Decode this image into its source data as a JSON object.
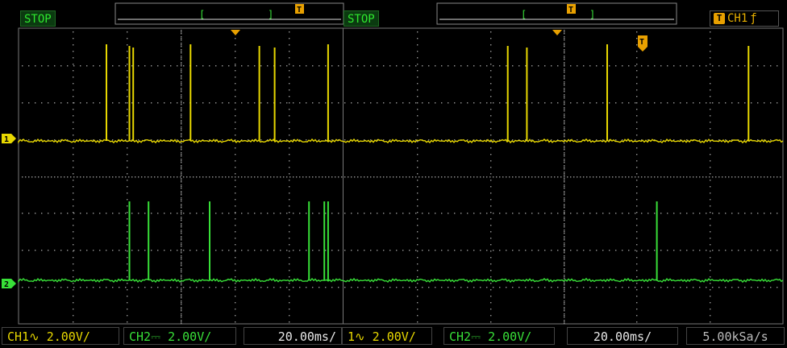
{
  "left_half": {
    "status": "STOP",
    "ch1_setting": "CH1∿  2.00V/",
    "ch2_setting": "CH2⎓  2.00V/",
    "timebase": "20.00ms/"
  },
  "right_half": {
    "status": "STOP",
    "ch1_setting": "1∿  2.00V/",
    "ch2_setting": "CH2⎓  2.00V/",
    "timebase": "20.00ms/",
    "sample_rate": "5.00kSa/s"
  },
  "trigger": {
    "source": "CH1",
    "edge_symbol": "ƒ",
    "marker_letter": "T"
  },
  "channel_markers": {
    "ch1": "1",
    "ch2": "2"
  },
  "colors": {
    "ch1": "#e8d800",
    "ch2": "#38e038",
    "trigger": "#e8a000",
    "grid": "#9a9a9a",
    "status_bg": "#0b3a10"
  },
  "traces": {
    "ch1_pulses_ms": [
      23,
      29,
      30,
      45,
      63,
      67,
      81,
      128,
      133,
      154,
      191
    ],
    "ch2_pulses_ms": [
      29,
      34,
      50,
      76,
      80,
      81,
      167
    ]
  }
}
